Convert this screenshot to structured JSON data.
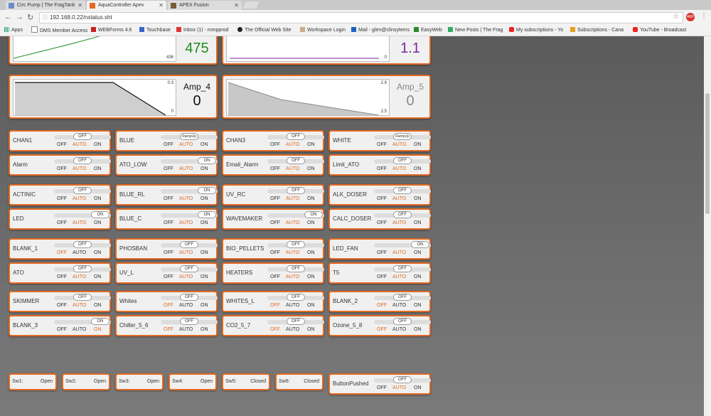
{
  "browser": {
    "tabs": [
      {
        "title": "Circ Pump | The FragTank",
        "active": false
      },
      {
        "title": "AquaController Apex",
        "active": true
      },
      {
        "title": "APEX Fusion",
        "active": false
      }
    ],
    "url": "192.168.0.22/nstatus.sht",
    "bookmarks": [
      "Apps",
      "DMS Member Access",
      "WEBForms 4.6",
      "Touchbase",
      "Inbox (1) - mmpprod",
      "The Official Web Site",
      "Workspace Login",
      "Mail - glen@clinsytems",
      "EasyWeb",
      "New Posts | The Frag",
      "My subscriptions - Yo",
      "Subscriptions - Cana",
      "YouTube - Broadcast"
    ]
  },
  "graphs": [
    {
      "name": "",
      "value": "475",
      "color": "#1e8c1e",
      "scale_top": "",
      "scale_bottom": "436"
    },
    {
      "name": "",
      "value": "1.1",
      "color": "#7a2a9a",
      "scale_top": "",
      "scale_bottom": "0"
    },
    {
      "name": "Amp_4",
      "value": "0",
      "color": "#111111",
      "scale_top": "0.3",
      "scale_bottom": "0"
    },
    {
      "name": "Amp_5",
      "value": "0",
      "color": "#888888",
      "scale_top": "2.9",
      "scale_bottom": "2.5"
    }
  ],
  "option_labels": {
    "off": "OFF",
    "auto": "AUTO",
    "on": "ON"
  },
  "outputs": [
    {
      "name": "CHAN1",
      "state": "OFF",
      "mode": "auto"
    },
    {
      "name": "BLUE",
      "state": "RampUp",
      "mode": "auto"
    },
    {
      "name": "CHAN3",
      "state": "OFF",
      "mode": "auto"
    },
    {
      "name": "WHITE",
      "state": "RampUp",
      "mode": "auto"
    },
    {
      "name": "Alarm",
      "state": "OFF",
      "mode": "auto"
    },
    {
      "name": "ATO_LOW",
      "state": "ON",
      "mode": "auto"
    },
    {
      "name": "Email_Alarm",
      "state": "OFF",
      "mode": "auto"
    },
    {
      "name": "Limit_ATO",
      "state": "OFF",
      "mode": "auto"
    },
    {
      "name": "ACTINIC",
      "state": "OFF",
      "mode": "auto"
    },
    {
      "name": "BLUE_RL",
      "state": "ON",
      "mode": "auto"
    },
    {
      "name": "UV_RC",
      "state": "OFF",
      "mode": "auto"
    },
    {
      "name": "ALK_DOSER",
      "state": "OFF",
      "mode": "auto"
    },
    {
      "name": "LED",
      "state": "ON",
      "mode": "auto"
    },
    {
      "name": "BLUE_C",
      "state": "ON",
      "mode": "auto"
    },
    {
      "name": "WAVEMAKER",
      "state": "ON",
      "mode": "auto"
    },
    {
      "name": "CALC_DOSER",
      "state": "OFF",
      "mode": "auto"
    },
    {
      "name": "BLANK_1",
      "state": "OFF",
      "mode": "off"
    },
    {
      "name": "PHOSBAN",
      "state": "OFF",
      "mode": "auto"
    },
    {
      "name": "BIO_PELLETS",
      "state": "OFF",
      "mode": "auto"
    },
    {
      "name": "LED_FAN",
      "state": "ON",
      "mode": "auto"
    },
    {
      "name": "ATO",
      "state": "OFF",
      "mode": "auto"
    },
    {
      "name": "UV_L",
      "state": "OFF",
      "mode": "auto"
    },
    {
      "name": "HEATERS",
      "state": "OFF",
      "mode": "auto"
    },
    {
      "name": "T5",
      "state": "OFF",
      "mode": "auto"
    },
    {
      "name": "SKIMMER",
      "state": "OFF",
      "mode": "auto"
    },
    {
      "name": "Whites",
      "state": "OFF",
      "mode": "off"
    },
    {
      "name": "WHITES_L",
      "state": "OFF",
      "mode": "off"
    },
    {
      "name": "BLANK_2",
      "state": "OFF",
      "mode": "off"
    },
    {
      "name": "BLANK_3",
      "state": "ON",
      "mode": "on"
    },
    {
      "name": "Chiller_5_6",
      "state": "OFF",
      "mode": "off"
    },
    {
      "name": "CO2_5_7",
      "state": "OFF",
      "mode": "off"
    },
    {
      "name": "Ozone_5_8",
      "state": "OFF",
      "mode": "off"
    }
  ],
  "switches": [
    {
      "name": "Sw1:",
      "value": "Open"
    },
    {
      "name": "Sw2:",
      "value": "Open"
    },
    {
      "name": "Sw3:",
      "value": "Open"
    },
    {
      "name": "Sw4:",
      "value": "Open"
    },
    {
      "name": "Sw5:",
      "value": "Closed"
    },
    {
      "name": "Sw6:",
      "value": "Closed"
    }
  ],
  "button_output": {
    "name": "ButtonPushed",
    "state": "OFF",
    "mode": "auto"
  }
}
